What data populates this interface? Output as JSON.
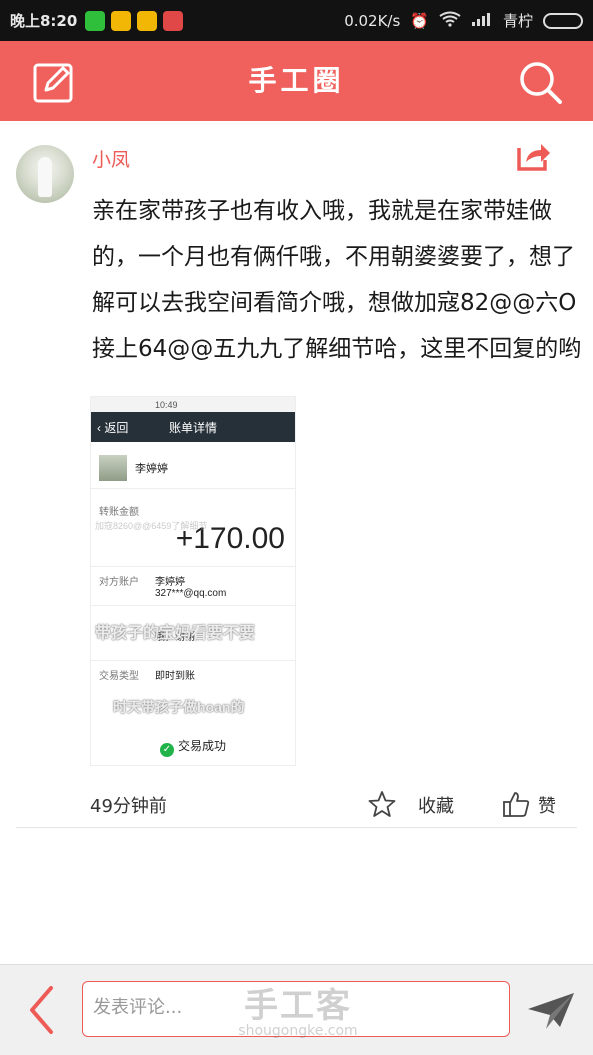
{
  "status_bar": {
    "time": "晚上8:20",
    "network_speed": "0.02K/s",
    "carrier": "青柠"
  },
  "header": {
    "title": "手工圈"
  },
  "post": {
    "author": "小凤",
    "content": "亲在家带孩子也有收入哦，我就是在家带娃做的，一个月也有俩仟哦，不用朝婆婆要了，想了解可以去我空间看简介哦，想做加寇82@@六O接上64@@五九九了解细节哈，这里不回复的哟",
    "time": "49分钟前",
    "favorite_label": "收藏",
    "like_label": "赞"
  },
  "receipt": {
    "status_time": "10:49",
    "back_label": "返回",
    "title": "账单详情",
    "payer": "李婷婷",
    "amount_label": "转账金额",
    "amount": "+170.00",
    "watermark_small": "加寇8260@@6459了解细节",
    "counterparty_label": "对方账户",
    "counterparty_name": "李婷婷",
    "counterparty_email": "327***@qq.com",
    "watermark_big": "带孩子的宝妈看要不要",
    "note": "哦，谢谢!",
    "type_label": "交易类型",
    "type_value": "即时到账",
    "watermark_bottom": "时天带孩子做hoan的",
    "success": "交易成功"
  },
  "comment_bar": {
    "placeholder": "发表评论..."
  },
  "brand": {
    "cn": "手工客",
    "en": "shougongke.com"
  },
  "colors": {
    "brand_red": "#f0615d",
    "status_bar": "#121212",
    "success_green": "#20b34a"
  }
}
